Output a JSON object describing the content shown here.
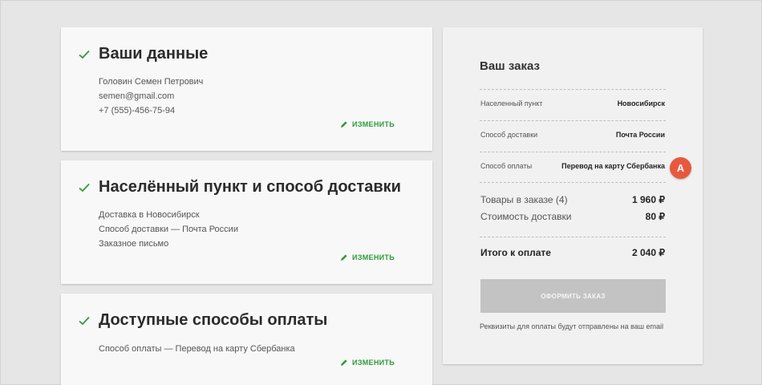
{
  "edit_label": "ИЗМЕНИТЬ",
  "sections": [
    {
      "title": "Ваши данные",
      "lines": [
        "Головин Семен Петрович",
        "semen@gmail.com",
        "+7 (555)-456-75-94"
      ]
    },
    {
      "title": "Населённый пункт и способ доставки",
      "lines": [
        "Доставка в Новосибирск",
        "Способ доставки — Почта России",
        "Заказное письмо"
      ]
    },
    {
      "title": "Доступные способы оплаты",
      "lines": [
        "Способ оплаты — Перевод на карту Сбербанка"
      ]
    }
  ],
  "order": {
    "title": "Ваш заказ",
    "details": [
      {
        "label": "Населенный пункт",
        "value": "Новосибирск"
      },
      {
        "label": "Способ доставки",
        "value": "Почта России"
      },
      {
        "label": "Способ оплаты",
        "value": "Перевод на карту Сбербанка"
      }
    ],
    "items": [
      {
        "label": "Товары в заказе (4)",
        "value": "1 960 ₽"
      },
      {
        "label": "Стоимость доставки",
        "value": "80 ₽"
      }
    ],
    "total": {
      "label": "Итого к оплате",
      "value": "2 040 ₽"
    },
    "submit_label": "ОФОРМИТЬ ЗАКАЗ",
    "note": "Реквизиты для оплаты будут отправлены на ваш email"
  },
  "annotation_marker": "A",
  "colors": {
    "accent_green": "#2f9a3b",
    "marker_red": "#e8583e",
    "button_disabled": "#c3c3c3"
  }
}
